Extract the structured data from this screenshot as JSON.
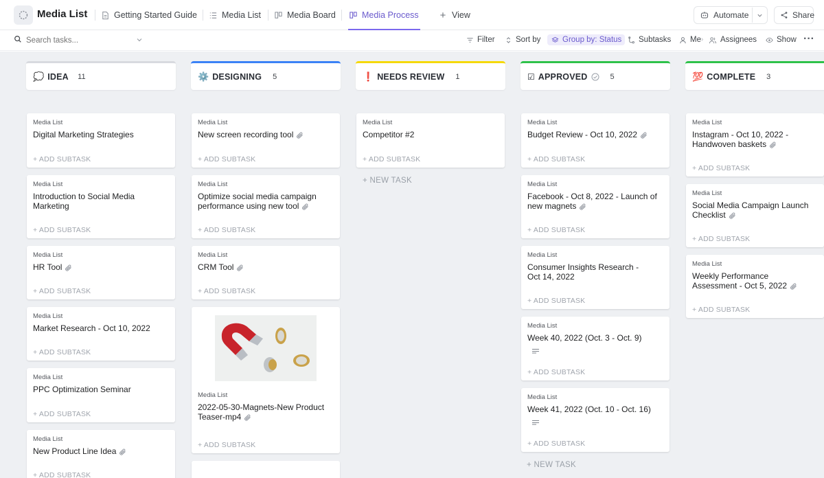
{
  "header": {
    "title": "Media List",
    "tabs": [
      {
        "label": "Getting Started Guide",
        "icon": "doc-icon"
      },
      {
        "label": "Media List",
        "icon": "list-icon"
      },
      {
        "label": "Media Board",
        "icon": "board-icon"
      },
      {
        "label": "Media Process",
        "icon": "board-icon",
        "active": true
      }
    ],
    "add_view_label": "View",
    "automate_label": "Automate",
    "share_label": "Share"
  },
  "toolbar": {
    "search_placeholder": "Search tasks...",
    "filter_label": "Filter",
    "sort_label": "Sort by",
    "group_label": "Group by: Status",
    "subtasks_label": "Subtasks",
    "me_label": "Me",
    "assignees_label": "Assignees",
    "show_label": "Show"
  },
  "colors": {
    "accent": "#7b68ee",
    "idea": "#d8dadf",
    "designing": "#3b82f6",
    "needs_review": "#f5d90a",
    "approved": "#2ec24a",
    "complete": "#2ec24a"
  },
  "columns": [
    {
      "name": "IDEA",
      "icon": "💭",
      "count": "11",
      "cards": [
        {
          "list": "Media List",
          "title": "Digital Marketing Strategies",
          "clip": false,
          "add": "+ ADD SUBTASK"
        },
        {
          "list": "Media List",
          "title": "Introduction to Social Media Marketing",
          "clip": false,
          "add": "+ ADD SUBTASK"
        },
        {
          "list": "Media List",
          "title": "HR Tool",
          "clip": true,
          "add": "+ ADD SUBTASK"
        },
        {
          "list": "Media List",
          "title": "Market Research - Oct 10, 2022",
          "clip": false,
          "add": "+ ADD SUBTASK"
        },
        {
          "list": "Media List",
          "title": "PPC Optimization Seminar",
          "clip": false,
          "add": "+ ADD SUBTASK"
        },
        {
          "list": "Media List",
          "title": "New Product Line Idea",
          "clip": true,
          "add": "+ ADD SUBTASK"
        }
      ]
    },
    {
      "name": "DESIGNING",
      "icon": "⚙️",
      "count": "5",
      "cards": [
        {
          "list": "Media List",
          "title": "New screen recording tool",
          "clip": true,
          "add": "+ ADD SUBTASK"
        },
        {
          "list": "Media List",
          "title": "Optimize social media campaign performance using new tool",
          "clip": true,
          "add": "+ ADD SUBTASK"
        },
        {
          "list": "Media List",
          "title": "CRM Tool",
          "clip": true,
          "add": "+ ADD SUBTASK"
        },
        {
          "list": "Media List",
          "title": "2022-05-30-Magnets-New Product Teaser-mp4",
          "clip": true,
          "add": "+ ADD SUBTASK",
          "image": "magnet-coins-image"
        }
      ]
    },
    {
      "name": "NEEDS REVIEW",
      "icon": "❗",
      "count": "1",
      "cards": [
        {
          "list": "Media List",
          "title": "Competitor #2",
          "clip": false,
          "add": "+ ADD SUBTASK"
        }
      ],
      "new_task": "+ NEW TASK"
    },
    {
      "name": "APPROVED",
      "icon": "☑",
      "count": "5",
      "cards": [
        {
          "list": "Media List",
          "title": "Budget Review - Oct 10, 2022",
          "clip": true,
          "add": "+ ADD SUBTASK"
        },
        {
          "list": "Media List",
          "title": "Facebook - Oct 8, 2022 - Launch of new magnets",
          "clip": true,
          "add": "+ ADD SUBTASK"
        },
        {
          "list": "Media List",
          "title": "Consumer Insights Research - Oct 14, 2022",
          "clip": false,
          "add": "+ ADD SUBTASK"
        },
        {
          "list": "Media List",
          "title": "Week 40, 2022 (Oct. 3 - Oct. 9)",
          "clip": false,
          "desc": true,
          "add": "+ ADD SUBTASK"
        },
        {
          "list": "Media List",
          "title": "Week 41, 2022 (Oct. 10 - Oct. 16)",
          "clip": false,
          "desc": true,
          "add": "+ ADD SUBTASK"
        }
      ],
      "new_task": "+ NEW TASK"
    },
    {
      "name": "COMPLETE",
      "icon": "💯",
      "count": "3",
      "cards": [
        {
          "list": "Media List",
          "title": "Instagram - Oct 10, 2022 - Handwoven baskets",
          "clip": true,
          "add": "+ ADD SUBTASK"
        },
        {
          "list": "Media List",
          "title": "Social Media Campaign Launch Checklist",
          "clip": true,
          "add": "+ ADD SUBTASK"
        },
        {
          "list": "Media List",
          "title": "Weekly Performance Assessment - Oct 5, 2022",
          "clip": true,
          "add": "+ ADD SUBTASK"
        }
      ]
    }
  ]
}
